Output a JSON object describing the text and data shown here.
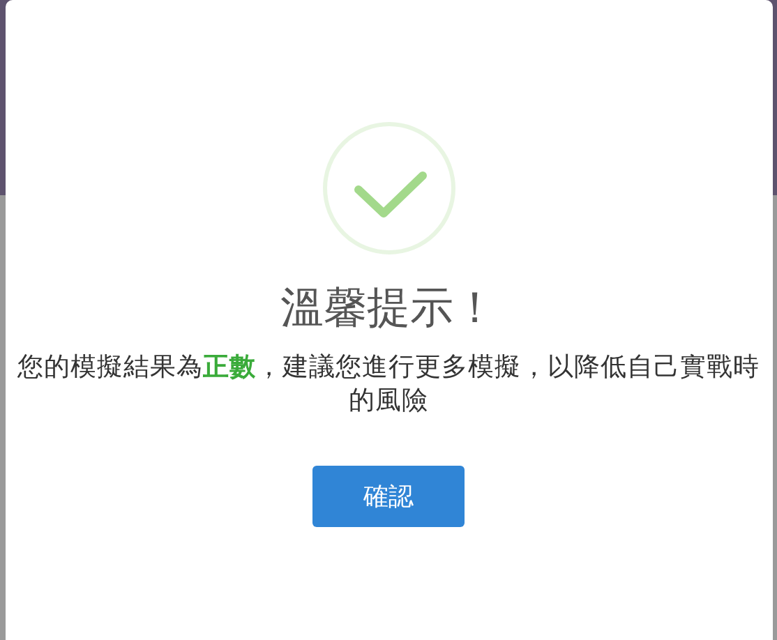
{
  "dialog": {
    "kind": "success",
    "title": "溫馨提示！",
    "message": "您的模擬結果為**正數**，建議您進行更多模擬，以降低自己實戰時的風險",
    "buttons": [
      {
        "label": "確認",
        "kind": "primary"
      }
    ]
  }
}
